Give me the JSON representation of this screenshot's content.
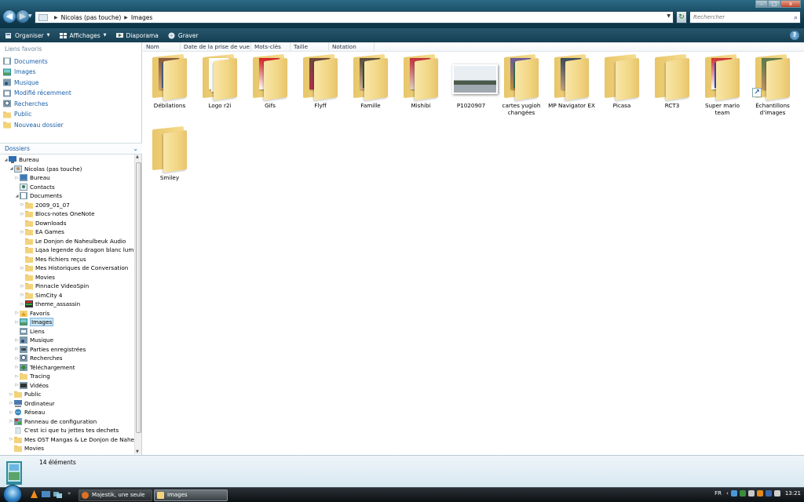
{
  "window": {
    "breadcrumb": [
      "Nicolas (pas touche)",
      "Images"
    ],
    "search_placeholder": "Rechercher"
  },
  "toolbar": {
    "items": [
      {
        "label": "Organiser",
        "icon": "organize-icon",
        "dropdown": true
      },
      {
        "label": "Affichages",
        "icon": "views-icon",
        "dropdown": true
      },
      {
        "label": "Diaporama",
        "icon": "slideshow-icon",
        "dropdown": false
      },
      {
        "label": "Graver",
        "icon": "burn-disc-icon",
        "dropdown": false
      }
    ],
    "help": "?"
  },
  "sidebar": {
    "favorites_title": "Liens favoris",
    "favorites": [
      {
        "label": "Documents",
        "icon": "documents-icon"
      },
      {
        "label": "Images",
        "icon": "pictures-icon"
      },
      {
        "label": "Musique",
        "icon": "music-icon"
      },
      {
        "label": "Modifié récemment",
        "icon": "recent-icon"
      },
      {
        "label": "Recherches",
        "icon": "search-folder-icon"
      },
      {
        "label": "Public",
        "icon": "folder-icon"
      },
      {
        "label": "Nouveau dossier",
        "icon": "folder-icon"
      }
    ],
    "folders_title": "Dossiers",
    "tree": [
      {
        "label": "Bureau",
        "depth": 0,
        "expander": "open",
        "icon": "desktop-icon"
      },
      {
        "label": "Nicolas (pas touche)",
        "depth": 1,
        "expander": "open",
        "icon": "user-folder-icon"
      },
      {
        "label": "Bureau",
        "depth": 2,
        "expander": "closed",
        "icon": "desktop-folder-icon"
      },
      {
        "label": "Contacts",
        "depth": 2,
        "expander": "none",
        "icon": "contacts-icon"
      },
      {
        "label": "Documents",
        "depth": 2,
        "expander": "open",
        "icon": "documents-icon"
      },
      {
        "label": "2009_01_07",
        "depth": 3,
        "expander": "closed",
        "icon": "folder-icon"
      },
      {
        "label": "Blocs-notes OneNote",
        "depth": 3,
        "expander": "closed",
        "icon": "folder-icon"
      },
      {
        "label": "Downloads",
        "depth": 3,
        "expander": "none",
        "icon": "folder-icon"
      },
      {
        "label": "EA Games",
        "depth": 3,
        "expander": "closed",
        "icon": "folder-icon"
      },
      {
        "label": "Le Donjon de Naheulbeuk Audio",
        "depth": 3,
        "expander": "none",
        "icon": "folder-icon"
      },
      {
        "label": "Lqaa legende du dragon blanc lumia",
        "depth": 3,
        "expander": "none",
        "icon": "folder-icon"
      },
      {
        "label": "Mes fichiers reçus",
        "depth": 3,
        "expander": "none",
        "icon": "folder-icon"
      },
      {
        "label": "Mes Historiques de Conversation",
        "depth": 3,
        "expander": "closed",
        "icon": "folder-icon"
      },
      {
        "label": "Movies",
        "depth": 3,
        "expander": "none",
        "icon": "folder-icon"
      },
      {
        "label": "Pinnacle VideoSpin",
        "depth": 3,
        "expander": "closed",
        "icon": "folder-icon"
      },
      {
        "label": "SimCity 4",
        "depth": 3,
        "expander": "closed",
        "icon": "folder-icon"
      },
      {
        "label": "theme_assassin",
        "depth": 3,
        "expander": "closed",
        "icon": "theme-icon"
      },
      {
        "label": "Favoris",
        "depth": 2,
        "expander": "closed",
        "icon": "favorites-folder-icon"
      },
      {
        "label": "Images",
        "depth": 2,
        "expander": "closed",
        "icon": "pictures-icon",
        "selected": true
      },
      {
        "label": "Liens",
        "depth": 2,
        "expander": "none",
        "icon": "links-folder-icon"
      },
      {
        "label": "Musique",
        "depth": 2,
        "expander": "closed",
        "icon": "music-icon"
      },
      {
        "label": "Parties enregistrées",
        "depth": 2,
        "expander": "closed",
        "icon": "saved-games-icon"
      },
      {
        "label": "Recherches",
        "depth": 2,
        "expander": "closed",
        "icon": "search-folder-icon"
      },
      {
        "label": "Téléchargement",
        "depth": 2,
        "expander": "closed",
        "icon": "downloads-icon"
      },
      {
        "label": "Tracing",
        "depth": 2,
        "expander": "closed",
        "icon": "folder-icon"
      },
      {
        "label": "Vidéos",
        "depth": 2,
        "expander": "closed",
        "icon": "videos-icon"
      },
      {
        "label": "Public",
        "depth": 1,
        "expander": "closed",
        "icon": "folder-icon"
      },
      {
        "label": "Ordinateur",
        "depth": 1,
        "expander": "closed",
        "icon": "computer-icon"
      },
      {
        "label": "Réseau",
        "depth": 1,
        "expander": "closed",
        "icon": "network-icon"
      },
      {
        "label": "Panneau de configuration",
        "depth": 1,
        "expander": "closed",
        "icon": "control-panel-icon"
      },
      {
        "label": "C'est ici que tu jettes tes dechets",
        "depth": 1,
        "expander": "none",
        "icon": "recycle-bin-icon"
      },
      {
        "label": "Mes OST Mangas & Le Donjon de Naheulb",
        "depth": 1,
        "expander": "closed",
        "icon": "folder-icon"
      },
      {
        "label": "Movies",
        "depth": 1,
        "expander": "none",
        "icon": "folder-icon"
      }
    ]
  },
  "columns": [
    "Nom",
    "Date de la prise de vue",
    "Mots-clés",
    "Taille",
    "Notation"
  ],
  "items": [
    {
      "label": "Débilations",
      "kind": "folder-photos",
      "colors": [
        "#8a5a3a",
        "#c9a27a",
        "#4a6a8a"
      ]
    },
    {
      "label": "Logo r2i",
      "kind": "folder-paper",
      "colors": [
        "#ffffff"
      ]
    },
    {
      "label": "Gifs",
      "kind": "folder-photos",
      "colors": [
        "#d21f1f",
        "#ffffff"
      ]
    },
    {
      "label": "Flyff",
      "kind": "folder-photos",
      "colors": [
        "#6a4a3a",
        "#b03050"
      ]
    },
    {
      "label": "Famille",
      "kind": "folder-photos",
      "colors": [
        "#5a4a3a",
        "#d0b090",
        "#3a5a3a"
      ]
    },
    {
      "label": "Mishibi",
      "kind": "folder-photos",
      "colors": [
        "#c0303a",
        "#e0d0c0"
      ]
    },
    {
      "label": "P1020907",
      "kind": "photo",
      "colors": [
        "#e8eef2",
        "#4a5a4a",
        "#a0a8b0"
      ]
    },
    {
      "label": "cartes yugioh changées",
      "kind": "folder-photos",
      "colors": [
        "#6a5a9a",
        "#c09040",
        "#3a7a5a"
      ]
    },
    {
      "label": "MP Navigator EX",
      "kind": "folder-photos",
      "colors": [
        "#3a4a5a",
        "#c0a080"
      ]
    },
    {
      "label": "Picasa",
      "kind": "folder-empty",
      "colors": []
    },
    {
      "label": "RCT3",
      "kind": "folder-empty",
      "colors": []
    },
    {
      "label": "Super mario team",
      "kind": "folder-photos",
      "colors": [
        "#d03030",
        "#ffffff",
        "#3050c0"
      ]
    },
    {
      "label": "Échantillons d'images",
      "kind": "folder-photos-shortcut",
      "colors": [
        "#5a7a4a",
        "#c09060"
      ]
    },
    {
      "label": "Smiley",
      "kind": "folder-empty",
      "colors": []
    }
  ],
  "status": {
    "count": "14 éléments"
  },
  "taskbar": {
    "tasks": [
      {
        "label": "Majestik, une seule ...",
        "icon": "firefox-icon",
        "active": false
      },
      {
        "label": "Images",
        "icon": "folder-icon",
        "active": true
      }
    ],
    "lang": "FR",
    "clock": "13:21"
  },
  "colors": {
    "titlebar": "#1a4a60",
    "link": "#1a5fa8",
    "folder": "#f1d684"
  }
}
